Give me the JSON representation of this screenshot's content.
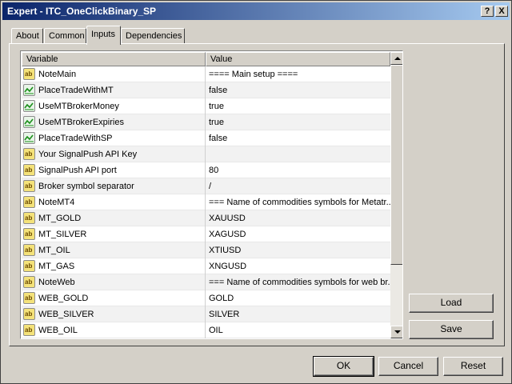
{
  "window": {
    "title": "Expert - ITC_OneClickBinary_SP",
    "help_label": "?",
    "close_label": "X"
  },
  "tabs": [
    {
      "label": "About"
    },
    {
      "label": "Common"
    },
    {
      "label": "Inputs"
    },
    {
      "label": "Dependencies"
    }
  ],
  "active_tab": "Inputs",
  "grid": {
    "columns": {
      "variable": "Variable",
      "value": "Value"
    },
    "rows": [
      {
        "icon": "text-param-icon",
        "icon_text": "ab",
        "variable": "NoteMain",
        "value": "==== Main setup ===="
      },
      {
        "icon": "bool-param-icon",
        "variable": "PlaceTradeWithMT",
        "value": "false"
      },
      {
        "icon": "bool-param-icon",
        "variable": "UseMTBrokerMoney",
        "value": "true"
      },
      {
        "icon": "bool-param-icon",
        "variable": "UseMTBrokerExpiries",
        "value": "true"
      },
      {
        "icon": "bool-param-icon",
        "variable": "PlaceTradeWithSP",
        "value": "false"
      },
      {
        "icon": "text-param-icon",
        "icon_text": "ab",
        "variable": "Your SignalPush API Key",
        "value": ""
      },
      {
        "icon": "text-param-icon",
        "icon_text": "ab",
        "variable": "SignalPush API port",
        "value": "80"
      },
      {
        "icon": "text-param-icon",
        "icon_text": "ab",
        "variable": "Broker symbol separator",
        "value": "/"
      },
      {
        "icon": "text-param-icon",
        "icon_text": "ab",
        "variable": "NoteMT4",
        "value": "=== Name of commodities symbols for Metatr..."
      },
      {
        "icon": "text-param-icon",
        "icon_text": "ab",
        "variable": "MT_GOLD",
        "value": "XAUUSD"
      },
      {
        "icon": "text-param-icon",
        "icon_text": "ab",
        "variable": "MT_SILVER",
        "value": "XAGUSD"
      },
      {
        "icon": "text-param-icon",
        "icon_text": "ab",
        "variable": "MT_OIL",
        "value": "XTIUSD"
      },
      {
        "icon": "text-param-icon",
        "icon_text": "ab",
        "variable": "MT_GAS",
        "value": "XNGUSD"
      },
      {
        "icon": "text-param-icon",
        "icon_text": "ab",
        "variable": "NoteWeb",
        "value": "=== Name of commodities symbols for web br..."
      },
      {
        "icon": "text-param-icon",
        "icon_text": "ab",
        "variable": "WEB_GOLD",
        "value": "GOLD"
      },
      {
        "icon": "text-param-icon",
        "icon_text": "ab",
        "variable": "WEB_SILVER",
        "value": "SILVER"
      },
      {
        "icon": "text-param-icon",
        "icon_text": "ab",
        "variable": "WEB_OIL",
        "value": "OIL"
      }
    ]
  },
  "side_buttons": {
    "load": "Load",
    "save": "Save"
  },
  "dialog_buttons": {
    "ok": "OK",
    "cancel": "Cancel",
    "reset": "Reset"
  },
  "colors": {
    "titlebar_start": "#0a246a",
    "titlebar_end": "#a6caf0",
    "face": "#d4d0c8"
  }
}
